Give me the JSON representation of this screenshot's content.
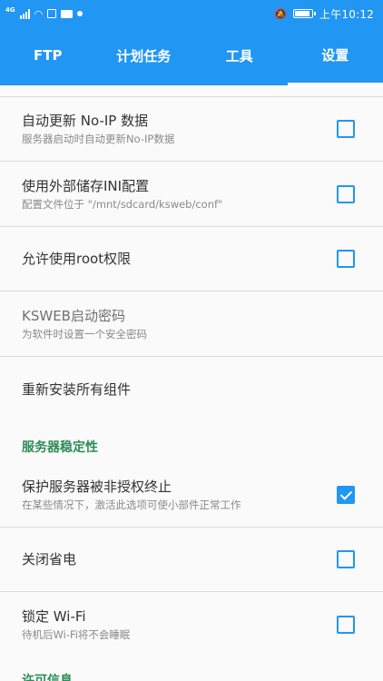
{
  "status_bar": {
    "network": "4G",
    "time": "上午10:12",
    "icons": [
      "signal-icon",
      "wifi-icon",
      "app-notification-icon",
      "mail-icon",
      "dot-icon",
      "mute-icon",
      "battery-icon"
    ],
    "battery_level": 0.9
  },
  "tabs": [
    {
      "label": "FTP",
      "selected": false
    },
    {
      "label": "计划任务",
      "selected": false
    },
    {
      "label": "工具",
      "selected": false
    },
    {
      "label": "设置",
      "selected": true
    }
  ],
  "settings": {
    "noip": {
      "title": "自动更新 No-IP 数据",
      "summary": "服务器启动时自动更新No-IP数据",
      "checked": false
    },
    "ext_storage": {
      "title": "使用外部储存INI配置",
      "summary": "配置文件位于 \"/mnt/sdcard/ksweb/conf\"",
      "checked": false
    },
    "root": {
      "title": "允许使用root权限",
      "checked": false
    },
    "password": {
      "title": "KSWEB启动密码",
      "summary": "为软件时设置一个安全密码"
    },
    "reinstall": {
      "title": "重新安装所有组件"
    },
    "stability_header": "服务器稳定性",
    "protect": {
      "title": "保护服务器被非授权终止",
      "summary": "在某些情况下，激活此选项可使小部件正常工作",
      "checked": true
    },
    "power_save": {
      "title": "关闭省电",
      "checked": false
    },
    "wifi_lock": {
      "title": "锁定 Wi-Fi",
      "summary": "待机后Wi-Fi将不会睡眠",
      "checked": false
    },
    "license_header": "许可信息"
  },
  "colors": {
    "primary": "#2196f3",
    "section_header": "#2e8b57"
  }
}
